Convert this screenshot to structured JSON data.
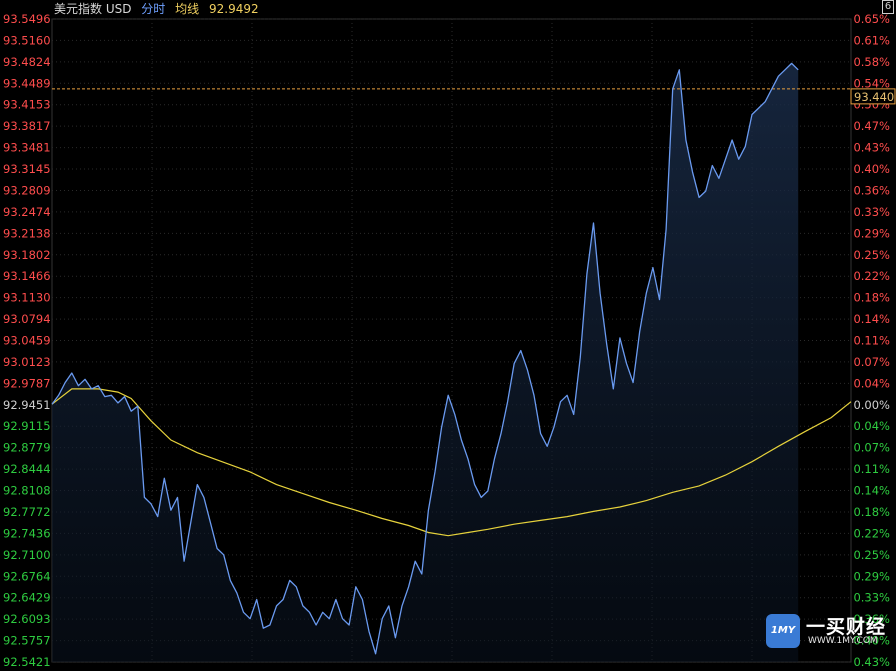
{
  "header": {
    "instrument": "美元指数 USD",
    "mode": "分时",
    "avg_label": "均线",
    "avg_value": "92.9492"
  },
  "corner_label": "6",
  "last_price_tag": "93.440",
  "watermark": {
    "logo": "1MY",
    "name": "一买财经",
    "url": "WWW.1MY.COM"
  },
  "colors": {
    "price_line": "#6a9af0",
    "avg_line": "#e6d23c",
    "up": "#ff4d4d",
    "down": "#2ecc40",
    "ref_dash": "#e8a040",
    "grid": "#2a2a2a"
  },
  "chart_data": {
    "type": "line",
    "title": "",
    "xlabel": "",
    "ylabel": "",
    "ylim": [
      92.5421,
      93.5496
    ],
    "ref_price": 92.9451,
    "reference_line": 93.4401,
    "left_ticks": [
      "93.5496",
      "93.5160",
      "93.4824",
      "93.4489",
      "93.4153",
      "93.3817",
      "93.3481",
      "93.3145",
      "93.2809",
      "93.2474",
      "93.2138",
      "93.1802",
      "93.1466",
      "93.1130",
      "93.0794",
      "93.0459",
      "93.0123",
      "92.9787",
      "92.9451",
      "92.9115",
      "92.8779",
      "92.8444",
      "92.8108",
      "92.7772",
      "92.7436",
      "92.7100",
      "92.6764",
      "92.6429",
      "92.6093",
      "92.5757",
      "92.5421"
    ],
    "right_ticks": [
      "0.65%",
      "0.61%",
      "0.58%",
      "0.54%",
      "0.50%",
      "0.47%",
      "0.43%",
      "0.40%",
      "0.36%",
      "0.33%",
      "0.29%",
      "0.25%",
      "0.22%",
      "0.18%",
      "0.14%",
      "0.11%",
      "0.07%",
      "0.04%",
      "0.00%",
      "0.04%",
      "0.07%",
      "0.11%",
      "0.14%",
      "0.18%",
      "0.22%",
      "0.25%",
      "0.29%",
      "0.33%",
      "0.36%",
      "0.40%",
      "0.43%"
    ],
    "series": [
      {
        "points": [
          [
            0,
            92.946
          ],
          [
            1,
            92.96
          ],
          [
            2,
            92.98
          ],
          [
            3,
            92.995
          ],
          [
            4,
            92.975
          ],
          [
            5,
            92.985
          ],
          [
            6,
            92.97
          ],
          [
            7,
            92.975
          ],
          [
            8,
            92.958
          ],
          [
            9,
            92.96
          ],
          [
            10,
            92.948
          ],
          [
            11,
            92.958
          ],
          [
            12,
            92.935
          ],
          [
            13,
            92.943
          ],
          [
            14,
            92.8
          ],
          [
            15,
            92.79
          ],
          [
            16,
            92.77
          ],
          [
            17,
            92.83
          ],
          [
            18,
            92.78
          ],
          [
            19,
            92.8
          ],
          [
            20,
            92.7
          ],
          [
            21,
            92.76
          ],
          [
            22,
            92.82
          ],
          [
            23,
            92.8
          ],
          [
            24,
            92.76
          ],
          [
            25,
            92.72
          ],
          [
            26,
            92.71
          ],
          [
            27,
            92.67
          ],
          [
            28,
            92.65
          ],
          [
            29,
            92.62
          ],
          [
            30,
            92.61
          ],
          [
            31,
            92.64
          ],
          [
            32,
            92.595
          ],
          [
            33,
            92.6
          ],
          [
            34,
            92.63
          ],
          [
            35,
            92.64
          ],
          [
            36,
            92.67
          ],
          [
            37,
            92.66
          ],
          [
            38,
            92.63
          ],
          [
            39,
            92.62
          ],
          [
            40,
            92.6
          ],
          [
            41,
            92.62
          ],
          [
            42,
            92.61
          ],
          [
            43,
            92.64
          ],
          [
            44,
            92.61
          ],
          [
            45,
            92.6
          ],
          [
            46,
            92.66
          ],
          [
            47,
            92.64
          ],
          [
            48,
            92.59
          ],
          [
            49,
            92.555
          ],
          [
            50,
            92.61
          ],
          [
            51,
            92.63
          ],
          [
            52,
            92.58
          ],
          [
            53,
            92.63
          ],
          [
            54,
            92.66
          ],
          [
            55,
            92.7
          ],
          [
            56,
            92.68
          ],
          [
            57,
            92.78
          ],
          [
            58,
            92.84
          ],
          [
            59,
            92.91
          ],
          [
            60,
            92.96
          ],
          [
            61,
            92.93
          ],
          [
            62,
            92.89
          ],
          [
            63,
            92.86
          ],
          [
            64,
            92.82
          ],
          [
            65,
            92.8
          ],
          [
            66,
            92.81
          ],
          [
            67,
            92.86
          ],
          [
            68,
            92.9
          ],
          [
            69,
            92.95
          ],
          [
            70,
            93.01
          ],
          [
            71,
            93.03
          ],
          [
            72,
            93.0
          ],
          [
            73,
            92.96
          ],
          [
            74,
            92.9
          ],
          [
            75,
            92.88
          ],
          [
            76,
            92.91
          ],
          [
            77,
            92.95
          ],
          [
            78,
            92.96
          ],
          [
            79,
            92.93
          ],
          [
            80,
            93.02
          ],
          [
            81,
            93.15
          ],
          [
            82,
            93.23
          ],
          [
            83,
            93.12
          ],
          [
            84,
            93.04
          ],
          [
            85,
            92.97
          ],
          [
            86,
            93.05
          ],
          [
            87,
            93.01
          ],
          [
            88,
            92.98
          ],
          [
            89,
            93.06
          ],
          [
            90,
            93.12
          ],
          [
            91,
            93.16
          ],
          [
            92,
            93.11
          ],
          [
            93,
            93.22
          ],
          [
            94,
            93.44
          ],
          [
            95,
            93.47
          ],
          [
            96,
            93.36
          ],
          [
            97,
            93.31
          ],
          [
            98,
            93.27
          ],
          [
            99,
            93.28
          ],
          [
            100,
            93.32
          ],
          [
            101,
            93.3
          ],
          [
            102,
            93.33
          ],
          [
            103,
            93.36
          ],
          [
            104,
            93.33
          ],
          [
            105,
            93.35
          ],
          [
            106,
            93.4
          ],
          [
            107,
            93.41
          ],
          [
            108,
            93.42
          ],
          [
            109,
            93.44
          ],
          [
            110,
            93.46
          ],
          [
            111,
            93.47
          ],
          [
            112,
            93.48
          ],
          [
            113,
            93.47
          ]
        ]
      },
      {
        "points": [
          [
            0,
            92.946
          ],
          [
            3,
            92.97
          ],
          [
            7,
            92.97
          ],
          [
            10,
            92.965
          ],
          [
            12,
            92.955
          ],
          [
            15,
            92.92
          ],
          [
            18,
            92.89
          ],
          [
            22,
            92.87
          ],
          [
            26,
            92.855
          ],
          [
            30,
            92.84
          ],
          [
            34,
            92.82
          ],
          [
            38,
            92.806
          ],
          [
            42,
            92.792
          ],
          [
            46,
            92.78
          ],
          [
            50,
            92.767
          ],
          [
            54,
            92.756
          ],
          [
            57,
            92.745
          ],
          [
            60,
            92.74
          ],
          [
            63,
            92.745
          ],
          [
            66,
            92.75
          ],
          [
            70,
            92.758
          ],
          [
            74,
            92.764
          ],
          [
            78,
            92.77
          ],
          [
            82,
            92.778
          ],
          [
            86,
            92.785
          ],
          [
            90,
            92.795
          ],
          [
            94,
            92.808
          ],
          [
            98,
            92.818
          ],
          [
            102,
            92.835
          ],
          [
            106,
            92.856
          ],
          [
            110,
            92.88
          ],
          [
            114,
            92.903
          ],
          [
            118,
            92.925
          ],
          [
            121,
            92.95
          ]
        ]
      }
    ]
  }
}
